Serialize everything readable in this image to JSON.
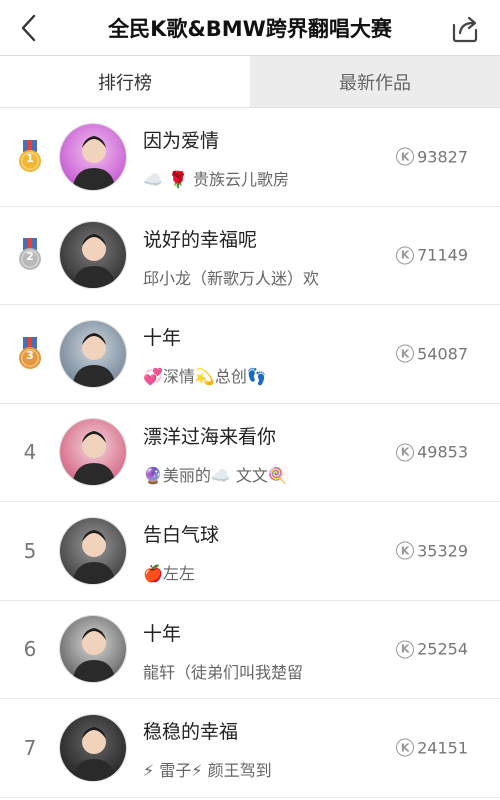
{
  "header": {
    "title": "全民K歌&BMW跨界翻唱大赛"
  },
  "tabs": [
    {
      "label": "排行榜",
      "active": true
    },
    {
      "label": "最新作品",
      "active": false
    }
  ],
  "k_icon_letter": "K",
  "rows": [
    {
      "rank": "1",
      "medal": "gold",
      "song": "因为爱情",
      "user": "贵族云儿歌房",
      "prefix": "☁️ 🌹",
      "score": "93827"
    },
    {
      "rank": "2",
      "medal": "silver",
      "song": "说好的幸福呢",
      "user": "邱小龙（新歌万人迷）欢",
      "prefix": "",
      "score": "71149"
    },
    {
      "rank": "3",
      "medal": "bronze",
      "song": "十年",
      "user": "💞深情💫总创👣",
      "prefix": "",
      "score": "54087"
    },
    {
      "rank": "4",
      "medal": "",
      "song": "漂洋过海来看你",
      "user": "🔮美丽的☁️ 文文🍭",
      "prefix": "",
      "score": "49853"
    },
    {
      "rank": "5",
      "medal": "",
      "song": "告白气球",
      "user": "🍎左左",
      "prefix": "",
      "score": "35329"
    },
    {
      "rank": "6",
      "medal": "",
      "song": "十年",
      "user": "龍轩（徒弟们叫我楚留",
      "prefix": "",
      "score": "25254"
    },
    {
      "rank": "7",
      "medal": "",
      "song": "稳稳的幸福",
      "user": "⚡ 雷子⚡ 颜王驾到",
      "prefix": "",
      "score": "24151"
    }
  ],
  "colors": {
    "gold": "#f2b733",
    "silver": "#b9b9b9",
    "bronze": "#e49a3c",
    "ribbon_blue": "#4a6fb5",
    "ribbon_red": "#e0433a"
  },
  "icons": {
    "back": "chevron-left-icon",
    "share": "share-icon",
    "score": "k-coin-icon"
  }
}
